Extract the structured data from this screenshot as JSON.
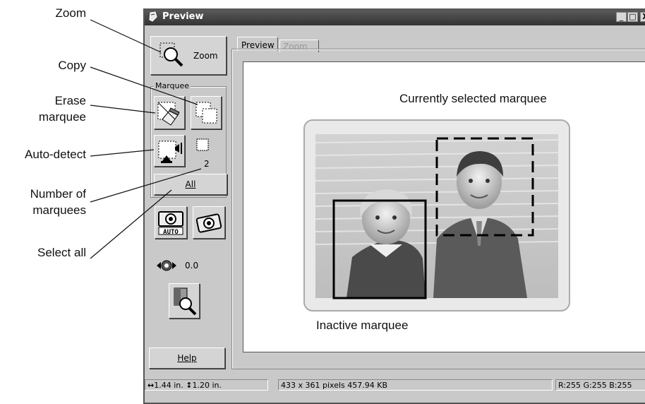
{
  "callouts": {
    "zoom": "Zoom",
    "copy": "Copy",
    "erase_1": "Erase",
    "erase_2": "marquee",
    "auto_detect": "Auto-detect",
    "number_1": "Number of",
    "number_2": "marquees",
    "select_all": "Select all"
  },
  "window": {
    "title": "Preview",
    "controls": {
      "minimize": "_",
      "maximize": "□",
      "close": "X"
    }
  },
  "toolbar": {
    "zoom_label": "Zoom",
    "marquee_group": "Marquee",
    "marquee_count": "2",
    "all_label": "All",
    "exposure_value": "0.0",
    "help_label": "Help"
  },
  "tabs": [
    {
      "label": "Preview",
      "active": true
    },
    {
      "label": "Zoom",
      "active": false
    }
  ],
  "preview": {
    "selected_caption": "Currently selected marquee",
    "inactive_caption": "Inactive marquee"
  },
  "status": {
    "width": "1.44 in.",
    "height": "1.20 in.",
    "info": "433 x 361 pixels 457.94 KB",
    "rgb": "R:255 G:255 B:255"
  },
  "icons": {
    "zoom": "zoom-magnifier-icon",
    "erase": "eraser-icon",
    "copy": "copy-marquee-icon",
    "auto_detect": "auto-detect-icon",
    "marquee_indicator": "marquee-indicator-icon",
    "auto_exposure": "auto-exposure-camera-icon",
    "exposure": "camera-exposure-icon",
    "densitometer": "densitometer-icon",
    "color_sample": "color-sample-icon"
  },
  "colors": {
    "titlebar": "#444444",
    "window": "#c9c9c9",
    "canvas": "#ffffff"
  }
}
